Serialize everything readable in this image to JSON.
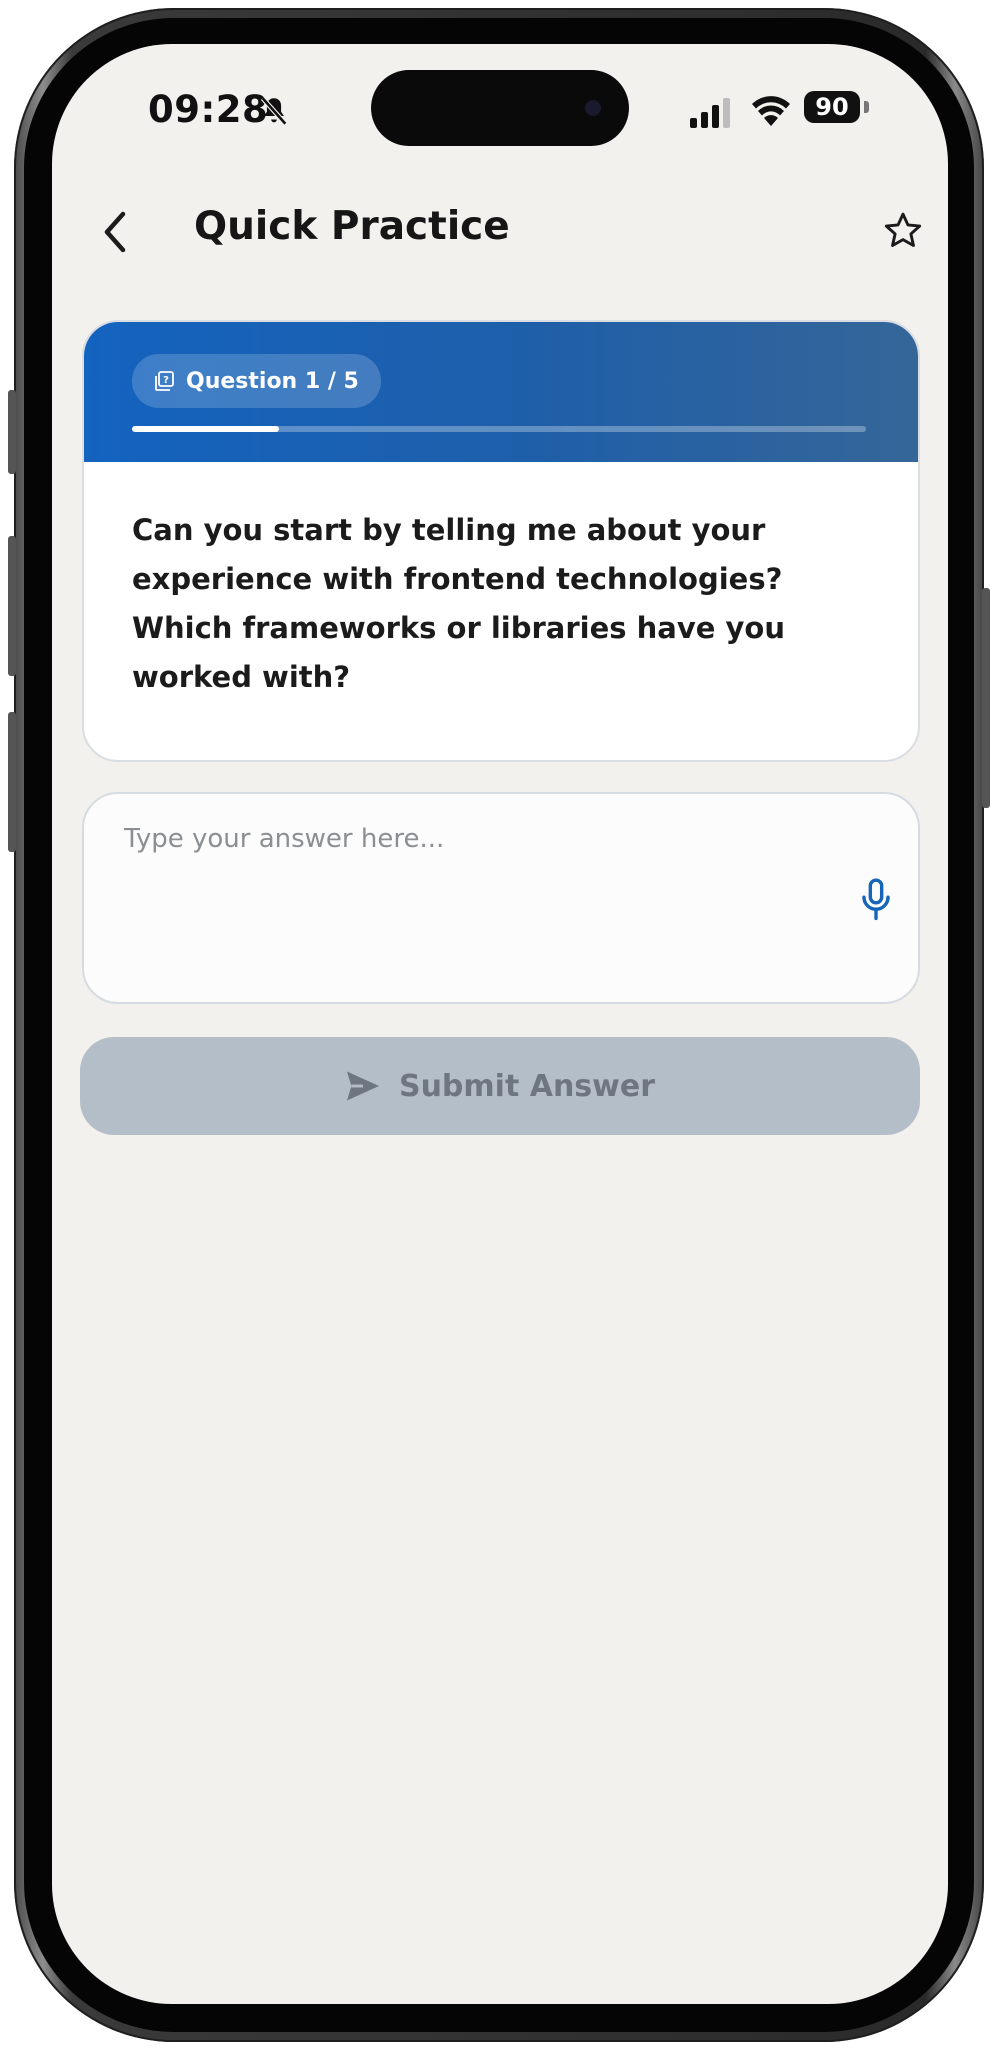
{
  "status_bar": {
    "time": "09:28",
    "battery": "90",
    "icons": [
      "bell-slash-icon",
      "cellular-signal-icon",
      "wifi-icon",
      "battery-icon"
    ]
  },
  "header": {
    "title": "Quick Practice",
    "back_icon": "chevron-left-icon",
    "favorite_icon": "star-outline-icon"
  },
  "question_card": {
    "badge_label": "Question 1 / 5",
    "badge_icon": "question-copy-icon",
    "progress": 0.2,
    "question": "Can you start by telling me about your experience with frontend technologies? Which frameworks or libraries have you worked with?"
  },
  "answer": {
    "placeholder": "Type your answer here...",
    "value": "",
    "mic_icon": "microphone-icon"
  },
  "submit": {
    "label": "Submit Answer",
    "icon": "send-icon",
    "enabled": false
  },
  "colors": {
    "header_gradient_start": "#1363bf",
    "header_gradient_end": "#356698",
    "background": "#f2f1ee",
    "submit_disabled": "#b4bec8",
    "mic_accent": "#1565b8"
  }
}
